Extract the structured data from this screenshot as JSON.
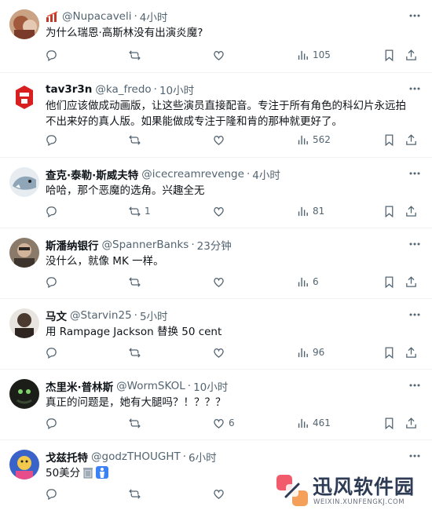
{
  "tweets": [
    {
      "name": "",
      "handle": "@Nupacaveli",
      "time": "4小时",
      "text": "为什么瑞恩·高斯林没有出演炎魔?",
      "counts": {
        "reply": "",
        "retweet": "",
        "like": "",
        "views": "105"
      },
      "avatar_color": "#c9a58a"
    },
    {
      "name": "tav3r3n",
      "handle": "@ka_fredo",
      "time": "10小时",
      "text": "他们应该做成动画版，让这些演员直接配音。专注于所有角色的科幻片永远拍不出来好的真人版。如果能做成专注于隆和肯的那种就更好了。",
      "counts": {
        "reply": "",
        "retweet": "",
        "like": "",
        "views": "562"
      },
      "avatar_color": "#d81e1e"
    },
    {
      "name": "查克·泰勒·斯威夫特",
      "handle": "@icecreamrevenge",
      "time": "4小时",
      "text": "哈哈，那个恶魔的选角。兴趣全无",
      "counts": {
        "reply": "",
        "retweet": "1",
        "like": "",
        "views": "81"
      },
      "avatar_color": "#8ea6b8"
    },
    {
      "name": "斯潘纳银行",
      "handle": "@SpannerBanks",
      "time": "23分钟",
      "text": "没什么，就像 MK 一样。",
      "counts": {
        "reply": "",
        "retweet": "",
        "like": "",
        "views": "6"
      },
      "avatar_color": "#6b5a4e"
    },
    {
      "name": "马文",
      "handle": "@Starvin25",
      "time": "5小时",
      "text": "用 Rampage Jackson 替换 50 cent",
      "counts": {
        "reply": "",
        "retweet": "",
        "like": "",
        "views": "96"
      },
      "avatar_color": "#5b4a3e"
    },
    {
      "name": "杰里米·普林斯",
      "handle": "@WormSKOL",
      "time": "10小时",
      "text": "真正的问题是，她有大腿吗？！？？？",
      "counts": {
        "reply": "",
        "retweet": "",
        "like": "6",
        "views": "461"
      },
      "avatar_color": "#1c1f1a"
    },
    {
      "name": "戈兹托特",
      "handle": "@godzTHOUGHT",
      "time": "6小时",
      "text": "50美分",
      "counts": {
        "reply": "",
        "retweet": "",
        "like": "",
        "views": ""
      },
      "avatar_color": "#3a63c9"
    }
  ],
  "separator": "·",
  "watermark": {
    "title": "迅风软件园",
    "subtitle": "WEIXIN.XUNFENGKJ.COM"
  },
  "colors": {
    "text": "#0f1419",
    "muted": "#536471",
    "divider": "#eff3f4"
  }
}
